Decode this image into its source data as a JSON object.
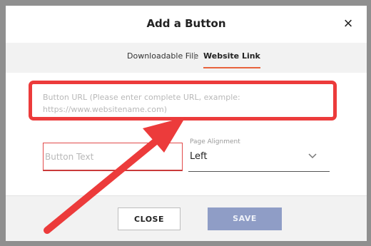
{
  "dialog": {
    "title": "Add a Button",
    "close_icon": "×"
  },
  "tabs": [
    {
      "label": "Downloadable File",
      "active": false
    },
    {
      "label": "Website Link",
      "active": true
    }
  ],
  "tab_separator": "|",
  "form": {
    "url_placeholder": "Button URL (Please enter complete URL, example:\nhttps://www.websitename.com)",
    "text_placeholder": "Button Text",
    "alignment_label": "Page Alignment",
    "alignment_value": "Left"
  },
  "buttons": {
    "close": "CLOSE",
    "save": "SAVE"
  },
  "colors": {
    "annotation": "#ec3b3b",
    "active_tab_underline": "#e8633c",
    "save_button": "#8f9dc6"
  }
}
